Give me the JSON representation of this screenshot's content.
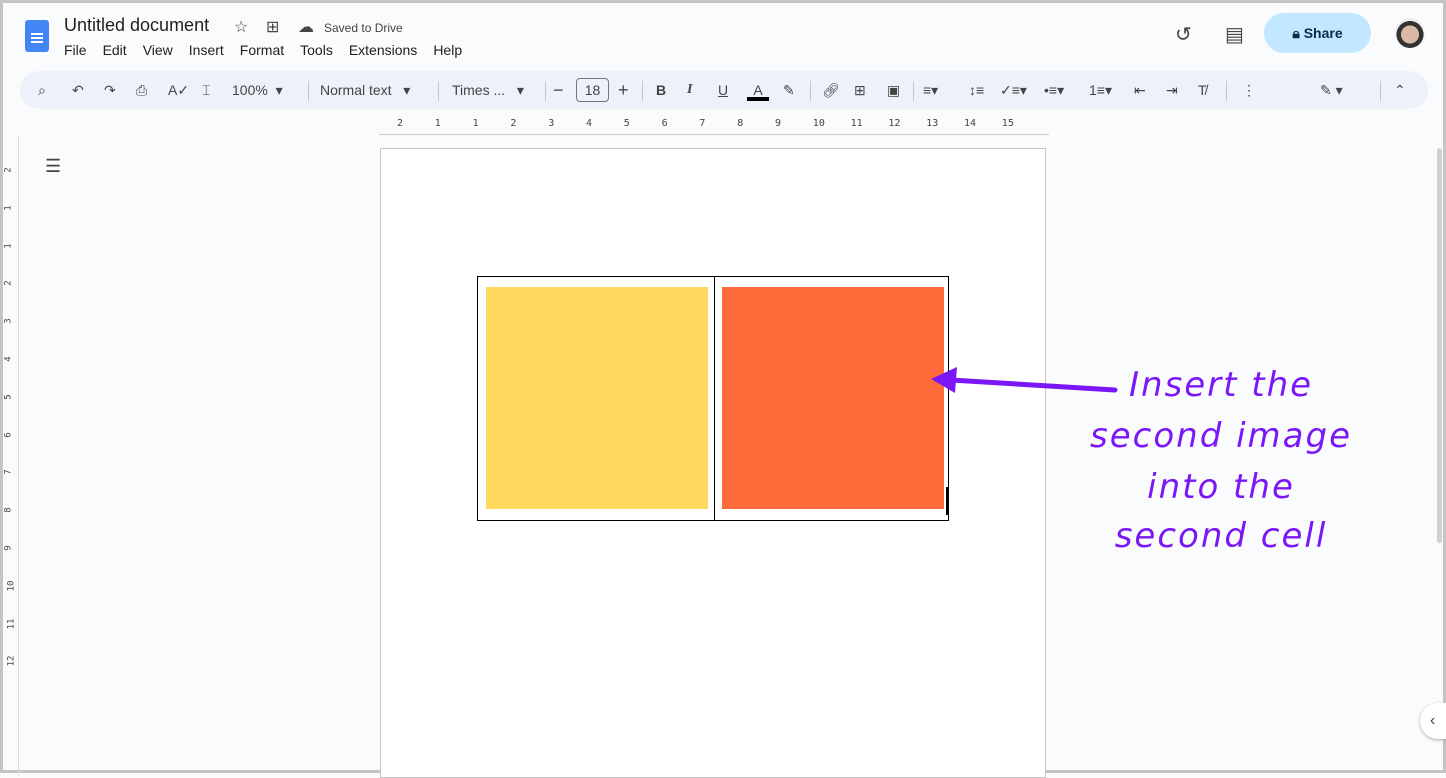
{
  "header": {
    "title": "Untitled document",
    "save_status": "Saved to Drive",
    "share_label": "Share",
    "menu": [
      "File",
      "Edit",
      "View",
      "Insert",
      "Format",
      "Tools",
      "Extensions",
      "Help"
    ]
  },
  "toolbar": {
    "zoom": "100%",
    "style": "Normal text",
    "font": "Times ...",
    "font_size": "18"
  },
  "ruler": {
    "horizontal": [
      "2",
      "1",
      "1",
      "2",
      "3",
      "4",
      "5",
      "6",
      "7",
      "8",
      "9",
      "10",
      "11",
      "12",
      "13",
      "14",
      "15"
    ],
    "vertical": [
      "2",
      "1",
      "1",
      "2",
      "3",
      "4",
      "5",
      "6",
      "7",
      "8",
      "9",
      "10",
      "11",
      "12"
    ]
  },
  "document": {
    "table": {
      "cells": [
        {
          "image_color": "#FFD95E"
        },
        {
          "image_color": "#FF6A3A"
        }
      ]
    }
  },
  "annotation": {
    "lines": [
      "Insert the",
      "second image",
      "into the",
      "second cell"
    ],
    "color": "#7B16F7"
  }
}
